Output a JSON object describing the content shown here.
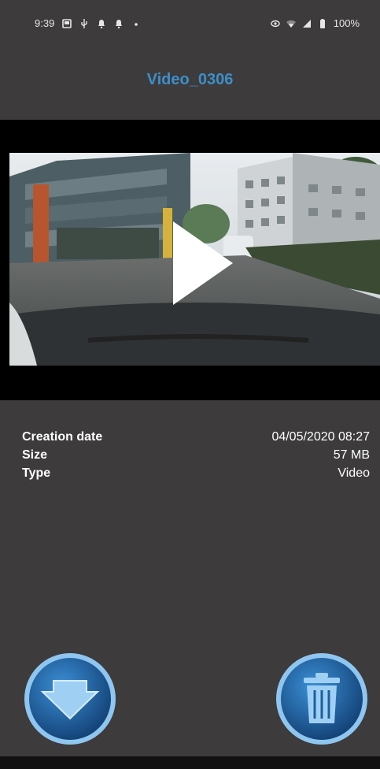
{
  "status_bar": {
    "time": "9:39",
    "battery": "100%",
    "left_icons": [
      "gallery-icon",
      "usb-icon",
      "notification-icon",
      "notification-icon",
      "dot-icon"
    ],
    "right_icons": [
      "eye-icon",
      "wifi-icon",
      "signal-icon",
      "battery-icon"
    ]
  },
  "header": {
    "title": "Video_0306",
    "title_color": "#3d8fc9"
  },
  "video": {
    "play_icon": "play-icon"
  },
  "details": {
    "rows": [
      {
        "label": "Creation date",
        "value": "04/05/2020 08:27"
      },
      {
        "label": "Size",
        "value": "57 MB"
      },
      {
        "label": "Type",
        "value": "Video"
      }
    ]
  },
  "actions": {
    "download_icon": "download-arrow-icon",
    "delete_icon": "trash-icon",
    "button_color": "#1d5f9e"
  }
}
